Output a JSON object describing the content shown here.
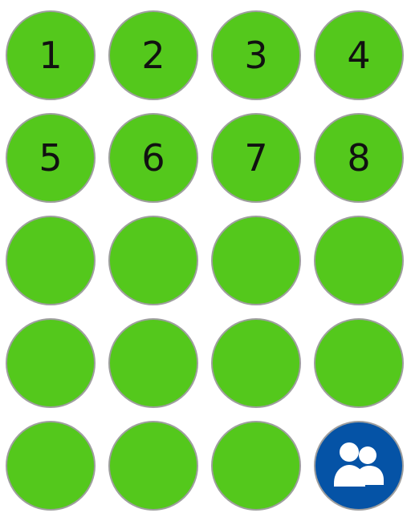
{
  "colors": {
    "tile_green": "#54c81c",
    "tile_blue": "#0553a6",
    "tile_border": "#9e9e9e",
    "label_color": "#111111",
    "icon_color": "#ffffff"
  },
  "tiles": [
    {
      "label": "1"
    },
    {
      "label": "2"
    },
    {
      "label": "3"
    },
    {
      "label": "4"
    },
    {
      "label": "5"
    },
    {
      "label": "6"
    },
    {
      "label": "7"
    },
    {
      "label": "8"
    },
    {
      "label": ""
    },
    {
      "label": ""
    },
    {
      "label": ""
    },
    {
      "label": ""
    },
    {
      "label": ""
    },
    {
      "label": ""
    },
    {
      "label": ""
    },
    {
      "label": ""
    },
    {
      "label": ""
    },
    {
      "label": ""
    },
    {
      "label": ""
    }
  ],
  "group_button": {
    "icon": "group-people-icon"
  }
}
